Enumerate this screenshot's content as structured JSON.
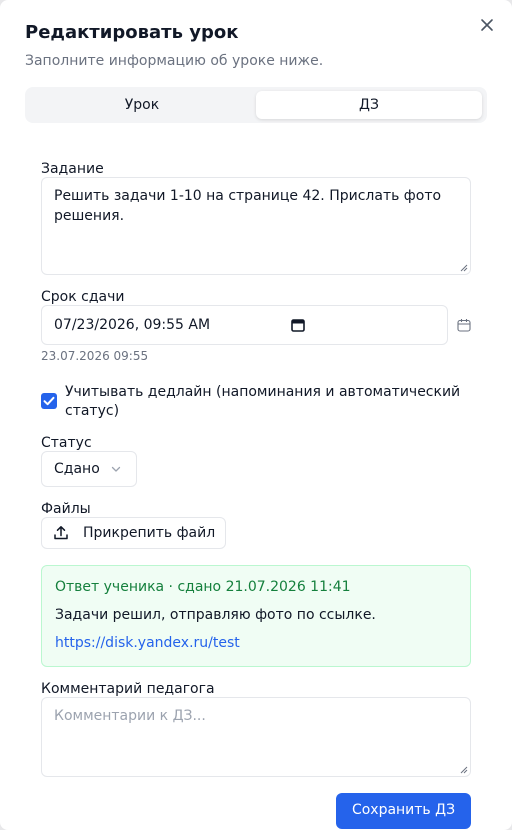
{
  "dialog": {
    "title": "Редактировать урок",
    "subtitle": "Заполните информацию об уроке ниже."
  },
  "tabs": [
    {
      "label": "Урок",
      "active": false
    },
    {
      "label": "ДЗ",
      "active": true
    }
  ],
  "task": {
    "label": "Задание",
    "value": "Решить задачи 1-10 на странице 42. Прислать фото решения."
  },
  "deadline": {
    "label": "Срок сдачи",
    "value": "07/23/2026, 09:55 AM",
    "hint": "23.07.2026 09:55"
  },
  "deadline_checkbox": {
    "checked": true,
    "label": "Учитывать дедлайн (напоминания и автоматический статус)"
  },
  "status": {
    "label": "Статус",
    "value": "Сдано"
  },
  "files": {
    "label": "Файлы",
    "attach_label": "Прикрепить файл"
  },
  "student_answer": {
    "header": "Ответ ученика · сдано 21.07.2026 11:41",
    "text": "Задачи решил, отправляю фото по ссылке.",
    "link": "https://disk.yandex.ru/test"
  },
  "teacher_comment": {
    "label": "Комментарий педагога",
    "placeholder": "Комментарии к ДЗ..."
  },
  "actions": {
    "save_label": "Сохранить ДЗ"
  },
  "colors": {
    "accent": "#2563eb",
    "success_bg": "#f0fdf4",
    "success_border": "#bbf7d0",
    "success_text": "#15803d"
  }
}
